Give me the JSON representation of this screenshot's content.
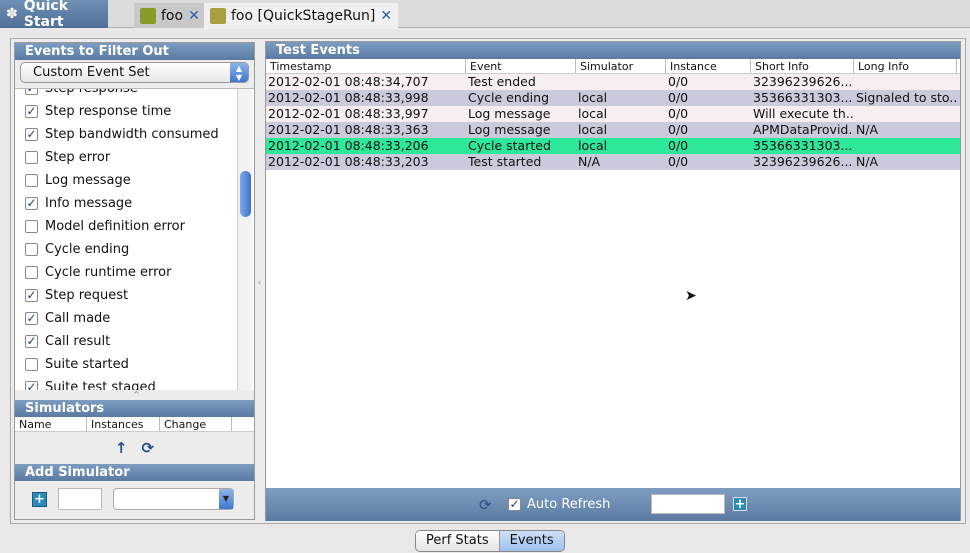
{
  "tabs": {
    "quick_start": "Quick Start",
    "tab1": "foo",
    "tab2": "foo [QuickStageRun]"
  },
  "filter": {
    "title": "Events to Filter Out",
    "selected_set": "Custom Event Set",
    "items": [
      {
        "label": "Step response",
        "checked": true
      },
      {
        "label": "Step response time",
        "checked": true
      },
      {
        "label": "Step bandwidth consumed",
        "checked": true
      },
      {
        "label": "Step error",
        "checked": false
      },
      {
        "label": "Log message",
        "checked": false
      },
      {
        "label": "Info message",
        "checked": true
      },
      {
        "label": "Model definition error",
        "checked": false
      },
      {
        "label": "Cycle ending",
        "checked": false
      },
      {
        "label": "Cycle runtime error",
        "checked": false
      },
      {
        "label": "Step request",
        "checked": true
      },
      {
        "label": "Call made",
        "checked": true
      },
      {
        "label": "Call result",
        "checked": true
      },
      {
        "label": "Suite started",
        "checked": false
      },
      {
        "label": "Suite test staged",
        "checked": true
      }
    ]
  },
  "simulators": {
    "title": "Simulators",
    "columns": [
      "Name",
      "Instances",
      "Change"
    ]
  },
  "add_simulator": {
    "title": "Add Simulator",
    "count_value": "",
    "type_value": ""
  },
  "events": {
    "title": "Test Events",
    "columns": [
      "Timestamp",
      "Event",
      "Simulator",
      "Instance",
      "Short Info",
      "Long Info"
    ],
    "rows": [
      [
        "2012-02-01 08:48:34,707",
        "Test ended",
        "",
        "0/0",
        "32396239626...",
        ""
      ],
      [
        "2012-02-01 08:48:33,998",
        "Cycle ending",
        "local",
        "0/0",
        "35366331303...",
        "Signaled to sto..."
      ],
      [
        "2012-02-01 08:48:33,997",
        "Log message",
        "local",
        "0/0",
        "Will execute th...",
        ""
      ],
      [
        "2012-02-01 08:48:33,363",
        "Log message",
        "local",
        "0/0",
        "APMDataProvid...",
        "N/A"
      ],
      [
        "2012-02-01 08:48:33,206",
        "Cycle started",
        "local",
        "0/0",
        "35366331303...",
        ""
      ],
      [
        "2012-02-01 08:48:33,203",
        "Test started",
        "N/A",
        "0/0",
        "32396239626...",
        "N/A"
      ]
    ],
    "row_colors": [
      "#f7eeee",
      "#c9cbdd",
      "#f7eeee",
      "#c9cbdd",
      "#2ee89a",
      "#c9cbdd"
    ],
    "auto_refresh_label": "Auto Refresh",
    "auto_refresh": true,
    "refresh_value": ""
  },
  "bottom_tabs": [
    "Perf Stats",
    "Events"
  ],
  "active_bottom_tab": "Events"
}
